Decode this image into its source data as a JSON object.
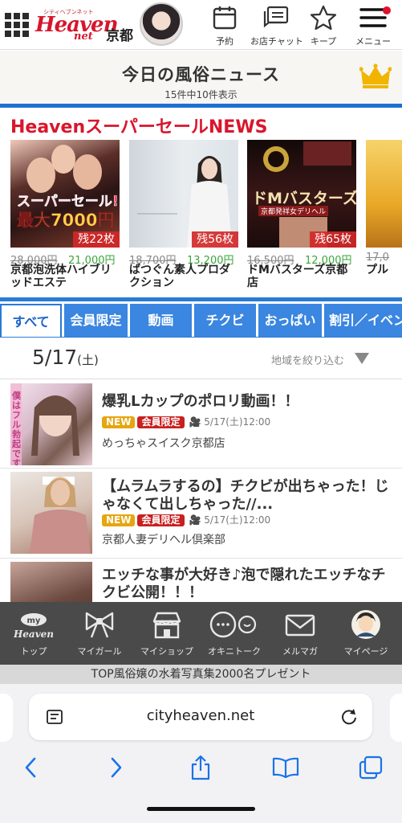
{
  "header": {
    "logo_tagline": "シティヘブンネット",
    "logo_main": "Heaven",
    "logo_sub": "net",
    "area": "京都",
    "buttons": [
      {
        "label": "予約",
        "icon": "calendar-icon"
      },
      {
        "label": "お店チャット",
        "icon": "chat-icon"
      },
      {
        "label": "キープ",
        "icon": "star-icon"
      },
      {
        "label": "メニュー",
        "icon": "hamburger-icon"
      }
    ]
  },
  "news": {
    "title": "今日の風俗ニュース",
    "count": "15件中10件表示"
  },
  "super_sale": {
    "title": "HeavenスーパーセールNEWS",
    "cards": [
      {
        "badge": "残22枚",
        "old_price": "28,000円",
        "new_price": "21,000円",
        "shop": "京都泡洗体ハイブリッドエステ",
        "img_text_1": "スーパーセール!!",
        "img_text_2": "最大7000円"
      },
      {
        "badge": "残56枚",
        "old_price": "18,700円",
        "new_price": "13,200円",
        "shop": "ばつぐん素人プロダクション"
      },
      {
        "badge": "残65枚",
        "old_price": "16,500円",
        "new_price": "12,000円",
        "shop": "ドMバスターズ京都店",
        "img_text_1": "ドMバスターズ",
        "img_text_2": "京都発祥女デリヘル"
      },
      {
        "old_price": "17,0",
        "shop": "プル"
      }
    ]
  },
  "tabs": [
    "すべて",
    "会員限定",
    "動画",
    "チクビ",
    "おっぱい",
    "割引／イベント"
  ],
  "date_row": {
    "date": "5/17",
    "weekday": "(土)",
    "filter": "地域を絞り込む"
  },
  "posts": [
    {
      "title": "爆乳Lカップのポロリ動画！！",
      "new": "NEW",
      "member": "会員限定",
      "time": "5/17(土)12:00",
      "shop": "めっちゃスイスク京都店",
      "img_text": "僕はフル勃起です"
    },
    {
      "title": "【ムラムラするの】チクビが出ちゃった！じゃなくて出しちゃった//...",
      "new": "NEW",
      "member": "会員限定",
      "time": "5/17(土)12:00",
      "shop": "京都人妻デリヘル倶楽部"
    },
    {
      "title": "エッチな事が大好き♪泡で隠れたエッチなチクビ公開！！！"
    }
  ],
  "bottom_nav": [
    {
      "label": "トップ",
      "icon": "my-heaven-icon",
      "icon_text_1": "my",
      "icon_text_2": "Heaven"
    },
    {
      "label": "マイガール",
      "icon": "ribbon-icon"
    },
    {
      "label": "マイショップ",
      "icon": "shop-icon"
    },
    {
      "label": "オキニトーク",
      "icon": "talk-icon"
    },
    {
      "label": "メルマガ",
      "icon": "mail-icon"
    },
    {
      "label": "マイページ",
      "icon": "user-avatar-icon"
    }
  ],
  "promo": "TOP風俗嬢の水着写真集2000名プレゼント",
  "browser": {
    "url": "cityheaven.net",
    "buttons": [
      "back-icon",
      "forward-icon",
      "share-icon",
      "bookmarks-icon",
      "tabs-icon"
    ]
  },
  "colors": {
    "brand_red": "#d6162d",
    "tab_blue": "#3a86e0",
    "nav_gray": "#4a4a4a",
    "price_green": "#3aa63a"
  }
}
